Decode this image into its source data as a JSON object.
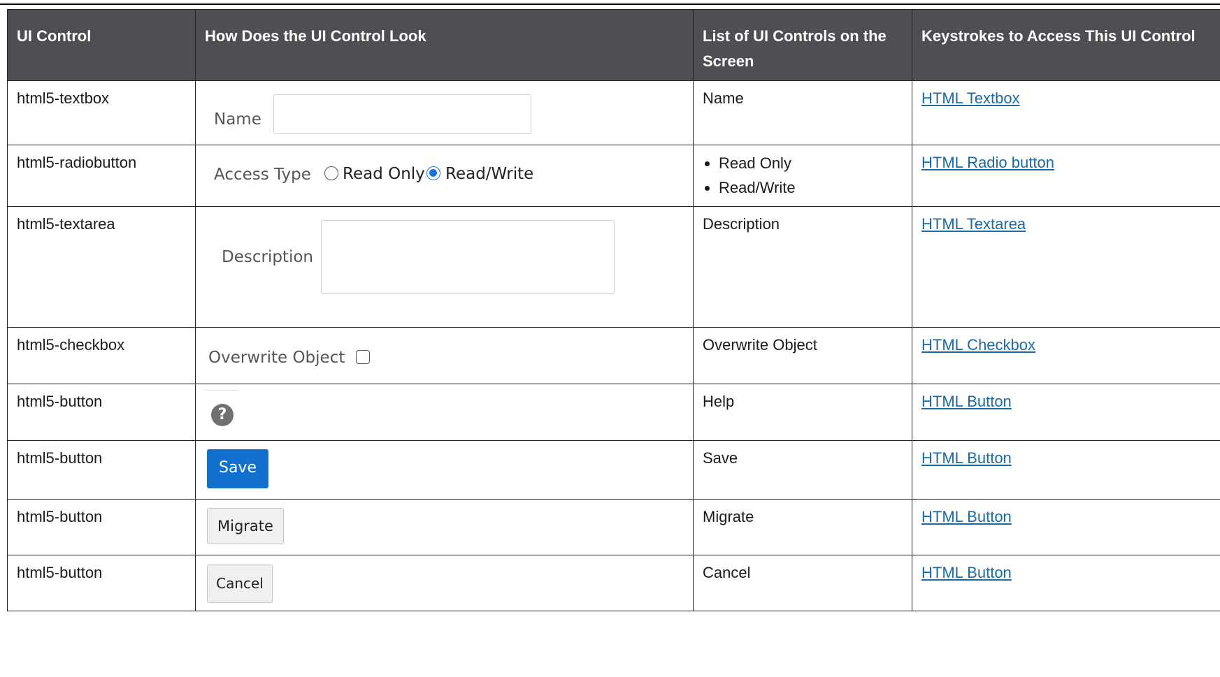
{
  "table": {
    "headers": [
      "UI Control",
      "How Does the UI Control Look",
      "List of UI Controls on the Screen",
      "Keystrokes to Access This UI Control"
    ],
    "rows": [
      {
        "control": "html5-textbox",
        "controls_list": [
          "Name"
        ],
        "link": "HTML Textbox"
      },
      {
        "control": "html5-radiobutton",
        "controls_list": [
          "Read Only",
          "Read/Write"
        ],
        "link": "HTML Radio button"
      },
      {
        "control": "html5-textarea",
        "controls_list": [
          "Description"
        ],
        "link": "HTML Textarea"
      },
      {
        "control": "html5-checkbox",
        "controls_list": [
          "Overwrite Object"
        ],
        "link": "HTML Checkbox"
      },
      {
        "control": "html5-button",
        "controls_list": [
          "Help"
        ],
        "link": "HTML Button"
      },
      {
        "control": "html5-button",
        "controls_list": [
          "Save"
        ],
        "link": "HTML Button"
      },
      {
        "control": "html5-button",
        "controls_list": [
          "Migrate"
        ],
        "link": "HTML Button"
      },
      {
        "control": "html5-button",
        "controls_list": [
          "Cancel"
        ],
        "link": "HTML Button"
      }
    ]
  },
  "previews": {
    "textbox": {
      "label": "Name",
      "value": ""
    },
    "radio": {
      "label": "Access Type",
      "options": [
        "Read Only",
        "Read/Write"
      ],
      "selected": "Read/Write"
    },
    "textarea": {
      "label": "Description",
      "value": ""
    },
    "checkbox": {
      "label": "Overwrite Object",
      "checked": false
    },
    "help": {
      "icon": "help-icon",
      "glyph": "?"
    },
    "save": {
      "label": "Save"
    },
    "migrate": {
      "label": "Migrate"
    },
    "cancel": {
      "label": "Cancel"
    }
  },
  "colors": {
    "header_bg": "#4d4f53",
    "link": "#1a6aa8",
    "primary_button": "#1270cf",
    "radio_selected": "#1a73e8"
  }
}
